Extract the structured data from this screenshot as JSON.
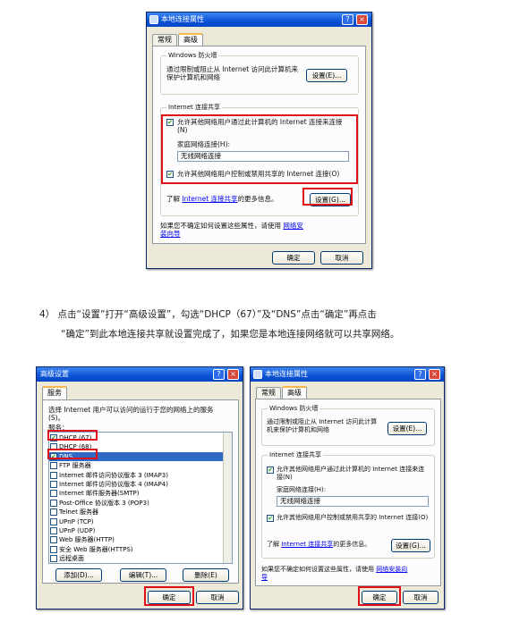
{
  "top_dialog": {
    "title": "本地连接属性",
    "tabs": [
      "常规",
      "高级"
    ],
    "firewall": {
      "title": "Windows 防火墙",
      "text": "通过限制或阻止从 Internet 访问此计算机来保护计算机和网络",
      "settings_btn": "设置(E)..."
    },
    "ics": {
      "title": "Internet 连接共享",
      "allow_text": "允许其他网络用户通过此计算机的 Internet 连接来连接(N)",
      "home_label": "家庭网络连接(H):",
      "home_value": "无线网络连接",
      "allow_control_text": "允许其他网络用户控制或禁用共享的 Internet 连接(O)",
      "learn_prefix": "了解",
      "learn_link": "Internet 连接共享",
      "learn_suffix": "的更多信息。",
      "settings_btn": "设置(G)..."
    },
    "wizard_text": "如果您不确定如何设置这些属性，请使用",
    "wizard_link": "网络安装向导",
    "ok": "确定",
    "cancel": "取消"
  },
  "instruction": {
    "line1": "4） 点击“设置”打开“高级设置”，勾选“DHCP（67）”及“DNS”点击“确定”再点击",
    "line2": "“确定”到此本地连接共享就设置完成了，如果您是本地连接网络就可以共享网络。"
  },
  "adv_dialog": {
    "title": "高级设置",
    "tab": "服务",
    "desc": "选择 Internet 用户可以访问的运行于您的网络上的服务(S)。",
    "services_label": "服务：",
    "services": [
      {
        "label": "DHCP (67)",
        "checked": true
      },
      {
        "label": "DHCP (68)",
        "checked": false
      },
      {
        "label": "DNS",
        "checked": true
      },
      {
        "label": "FTP 服务器",
        "checked": false
      },
      {
        "label": "Internet 邮件访问协议版本 3 (IMAP3)",
        "checked": false
      },
      {
        "label": "Internet 邮件访问协议版本 4 (IMAP4)",
        "checked": false
      },
      {
        "label": "Internet 邮件服务器(SMTP)",
        "checked": false
      },
      {
        "label": "Post-Office 协议版本 3 (POP3)",
        "checked": false
      },
      {
        "label": "Telnet 服务器",
        "checked": false
      },
      {
        "label": "UPnP (TCP)",
        "checked": false
      },
      {
        "label": "UPnP (UDP)",
        "checked": false
      },
      {
        "label": "Web 服务器(HTTP)",
        "checked": false
      },
      {
        "label": "安全 Web 服务器(HTTPS)",
        "checked": false
      },
      {
        "label": "远程桌面",
        "checked": false
      }
    ],
    "add_btn": "添加(D)...",
    "edit_btn": "编辑(T)...",
    "delete_btn": "删除(E)",
    "ok": "确定",
    "cancel": "取消"
  },
  "right_dialog": {
    "title": "本地连接属性",
    "tabs": [
      "常规",
      "高级"
    ],
    "firewall_title": "Windows 防火墙",
    "firewall_text": "通过限制或阻止从 Internet 访问此计算机来保护计算机和网络",
    "firewall_btn": "设置(E)...",
    "ics_title": "Internet 连接共享",
    "allow_text": "允许其他网络用户通过此计算机的 Internet 连接来连接(N)",
    "home_label": "家庭网络连接(H):",
    "home_value": "无线网络连接",
    "allow_control_text": "允许其他网络用户控制或禁用共享的 Internet 连接(O)",
    "learn_prefix": "了解",
    "learn_link": "Internet 连接共享",
    "learn_suffix": "的更多信息。",
    "ics_btn": "设置(G)...",
    "wizard_text": "如果您不确定如何设置这些属性，请使用",
    "wizard_link": "网络安装向导",
    "ok": "确定",
    "cancel": "取消"
  },
  "colors": {
    "highlight": "#e0101a",
    "titlebar": "#0b52d6",
    "dialog_bg": "#ece9d8"
  }
}
